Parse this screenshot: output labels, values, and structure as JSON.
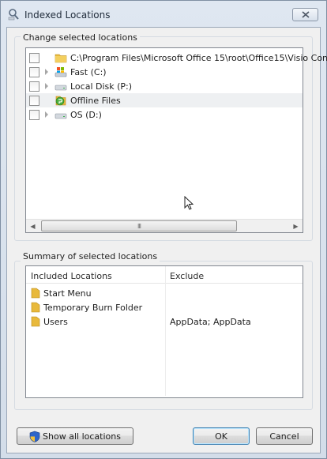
{
  "window": {
    "title": "Indexed Locations"
  },
  "change_group": {
    "label": "Change selected locations",
    "tree": [
      {
        "label": "C:\\Program Files\\Microsoft Office 15\\root\\Office15\\Visio Cont",
        "icon": "folder-icon",
        "expandable": false,
        "checked": false,
        "selected": false
      },
      {
        "label": "Fast (C:)",
        "icon": "system-drive-icon",
        "expandable": true,
        "checked": false,
        "selected": false
      },
      {
        "label": "Local Disk (P:)",
        "icon": "drive-icon",
        "expandable": true,
        "checked": false,
        "selected": false
      },
      {
        "label": "Offline Files",
        "icon": "offline-files-icon",
        "expandable": false,
        "checked": false,
        "selected": true
      },
      {
        "label": "OS (D:)",
        "icon": "drive-icon",
        "expandable": true,
        "checked": false,
        "selected": false
      }
    ],
    "scrollbar_grip": "III"
  },
  "summary_group": {
    "label": "Summary of selected locations",
    "columns": {
      "included": "Included Locations",
      "exclude": "Exclude"
    },
    "rows": [
      {
        "name": "Start Menu",
        "exclude": ""
      },
      {
        "name": "Temporary Burn Folder",
        "exclude": ""
      },
      {
        "name": "Users",
        "exclude": "AppData; AppData"
      }
    ]
  },
  "buttons": {
    "show_all": "Show all locations",
    "ok": "OK",
    "cancel": "Cancel"
  },
  "colors": {
    "accent": "#3c7fb1",
    "folder": "#e8b93c",
    "selected_row": "#eef0f2"
  }
}
